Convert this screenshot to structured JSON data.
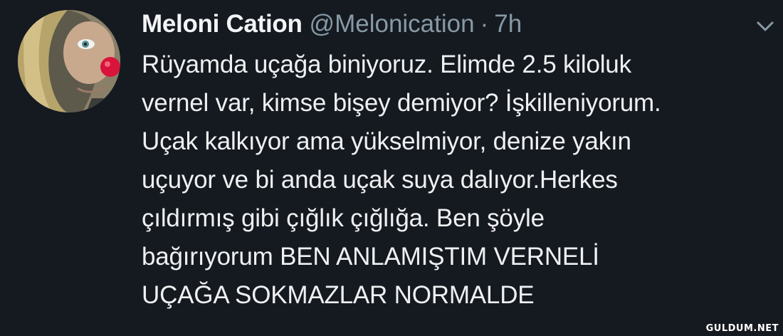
{
  "tweet": {
    "display_name": "Meloni Cation",
    "handle": "@Melonication",
    "separator": "·",
    "time": "7h",
    "lines": [
      "Rüyamda uçağa biniyoruz. Elimde 2.5 kiloluk",
      "vernel var, kimse bişey demiyor? İşkilleniyorum.",
      "Uçak kalkıyor ama yükselmiyor, denize yakın",
      "uçuyor ve bi anda uçak suya dalıyor.Herkes",
      "çıldırmış gibi çığlık çığlığa. Ben şöyle",
      "bağırıyorum BEN ANLAMIŞTIM VERNELİ",
      "UÇAĞA SOKMAZLAR NORMALDE"
    ],
    "menu_icon": "chevron-down-icon",
    "avatar_icon": "profile-photo"
  },
  "watermark": "GULDUM.NET",
  "colors": {
    "background": "#151a21",
    "text": "#eef0f2",
    "secondary_text": "#8899a6"
  }
}
